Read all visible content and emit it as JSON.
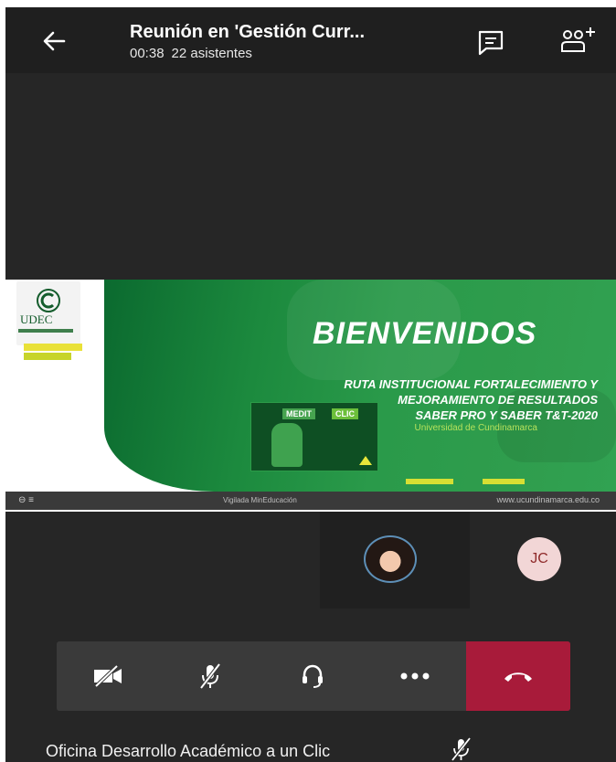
{
  "header": {
    "title": "Reunión en 'Gestión Curr...",
    "elapsed": "00:38",
    "attendees": "22 asistentes"
  },
  "slide": {
    "logo_text": "UDEC",
    "welcome": "BIENVENIDOS",
    "route_line1": "RUTA INSTITUCIONAL FORTALECIMIENTO Y",
    "route_line2": "MEJORAMIENTO DE RESULTADOS",
    "route_line3": "SABER PRO Y SABER T&T-2020",
    "university": "Universidad de Cundinamarca",
    "card_label_left": "MEDIT",
    "card_label_right": "CLIC",
    "bar_left": "⊖ ≡",
    "bar_mid": "Vigilada MinEducación",
    "bar_right": "www.ucundinamarca.edu.co"
  },
  "participants": [
    {
      "initials": ""
    },
    {
      "initials": "JC"
    }
  ],
  "meeting_name": "Oficina Desarrollo Académico a un Clic",
  "colors": {
    "background": "#262626",
    "header": "#1f1f1f",
    "hangup": "#a81b3a",
    "controls": "#3a3a3a"
  }
}
